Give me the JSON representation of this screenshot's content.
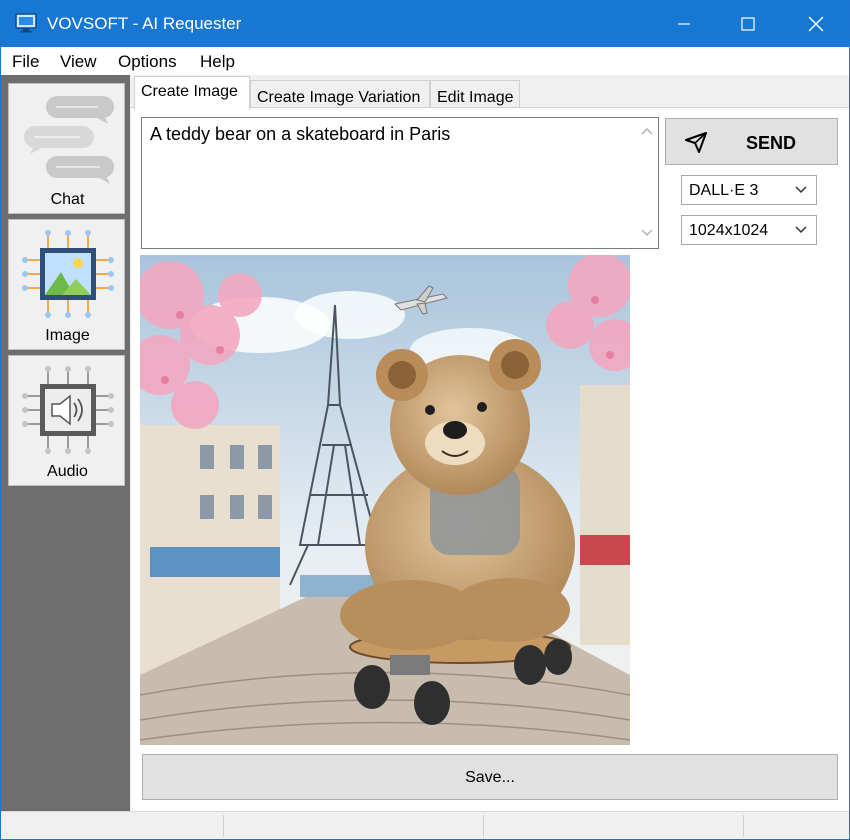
{
  "window": {
    "title": "VOVSOFT - AI Requester",
    "accent": "#1778d3"
  },
  "menu": {
    "items": [
      "File",
      "View",
      "Options",
      "Help"
    ]
  },
  "sidebar": {
    "items": [
      {
        "label": "Chat",
        "icon": "chat-bubbles-icon"
      },
      {
        "label": "Image",
        "icon": "image-chip-icon"
      },
      {
        "label": "Audio",
        "icon": "speaker-chip-icon"
      }
    ],
    "background": "#6e6e6e"
  },
  "tabs": [
    {
      "label": "Create Image",
      "active": true
    },
    {
      "label": "Create Image Variation",
      "active": false
    },
    {
      "label": "Edit Image",
      "active": false
    }
  ],
  "prompt": {
    "value": "A teddy bear on a skateboard in Paris"
  },
  "send": {
    "label": "SEND",
    "icon": "paper-plane-icon"
  },
  "model_select": {
    "value": "DALL·E 3"
  },
  "size_select": {
    "value": "1024x1024"
  },
  "result_image": {
    "subject": "teddy-bear-skateboard-paris-illustration"
  },
  "save": {
    "label": "Save..."
  }
}
